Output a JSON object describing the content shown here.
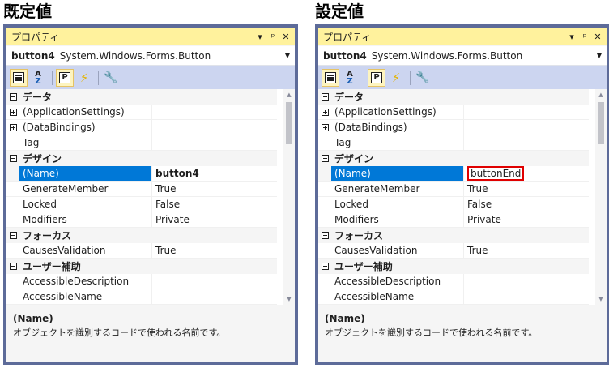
{
  "headings": {
    "left": "既定値",
    "right": "設定値"
  },
  "window": {
    "title": "プロパティ",
    "dropdown_glyph": "▾",
    "pin_glyph": "ᵖ",
    "close_glyph": "✕"
  },
  "object": {
    "name": "button4",
    "type": "System.Windows.Forms.Button"
  },
  "toolbar_icons": [
    "categorized-icon",
    "alphabetical-icon",
    "properties-icon",
    "events-icon",
    "property-pages-icon"
  ],
  "rows_left": [
    {
      "kind": "category",
      "label": "データ"
    },
    {
      "kind": "property",
      "name": "(ApplicationSettings)",
      "value": "",
      "expandable": true
    },
    {
      "kind": "property",
      "name": "(DataBindings)",
      "value": "",
      "expandable": true
    },
    {
      "kind": "property",
      "name": "Tag",
      "value": ""
    },
    {
      "kind": "category",
      "label": "デザイン"
    },
    {
      "kind": "property",
      "name": "(Name)",
      "value": "button4",
      "selected": true,
      "bold": true
    },
    {
      "kind": "property",
      "name": "GenerateMember",
      "value": "True"
    },
    {
      "kind": "property",
      "name": "Locked",
      "value": "False"
    },
    {
      "kind": "property",
      "name": "Modifiers",
      "value": "Private"
    },
    {
      "kind": "category",
      "label": "フォーカス"
    },
    {
      "kind": "property",
      "name": "CausesValidation",
      "value": "True"
    },
    {
      "kind": "category",
      "label": "ユーザー補助"
    },
    {
      "kind": "property",
      "name": "AccessibleDescription",
      "value": ""
    },
    {
      "kind": "property",
      "name": "AccessibleName",
      "value": ""
    }
  ],
  "rows_right": [
    {
      "kind": "category",
      "label": "データ"
    },
    {
      "kind": "property",
      "name": "(ApplicationSettings)",
      "value": "",
      "expandable": true
    },
    {
      "kind": "property",
      "name": "(DataBindings)",
      "value": "",
      "expandable": true
    },
    {
      "kind": "property",
      "name": "Tag",
      "value": ""
    },
    {
      "kind": "category",
      "label": "デザイン"
    },
    {
      "kind": "property",
      "name": "(Name)",
      "value": "buttonEnd",
      "selected": true,
      "editing": true
    },
    {
      "kind": "property",
      "name": "GenerateMember",
      "value": "True"
    },
    {
      "kind": "property",
      "name": "Locked",
      "value": "False"
    },
    {
      "kind": "property",
      "name": "Modifiers",
      "value": "Private"
    },
    {
      "kind": "category",
      "label": "フォーカス"
    },
    {
      "kind": "property",
      "name": "CausesValidation",
      "value": "True"
    },
    {
      "kind": "category",
      "label": "ユーザー補助"
    },
    {
      "kind": "property",
      "name": "AccessibleDescription",
      "value": ""
    },
    {
      "kind": "property",
      "name": "AccessibleName",
      "value": ""
    }
  ],
  "description": {
    "name": "(Name)",
    "text": "オブジェクトを識別するコードで使われる名前です。"
  },
  "colors": {
    "selection": "#0078d7",
    "title_bar": "#fff29d",
    "toolbar": "#ccd5f0",
    "frame": "#5d6b99",
    "edit_highlight": "#e00000"
  }
}
